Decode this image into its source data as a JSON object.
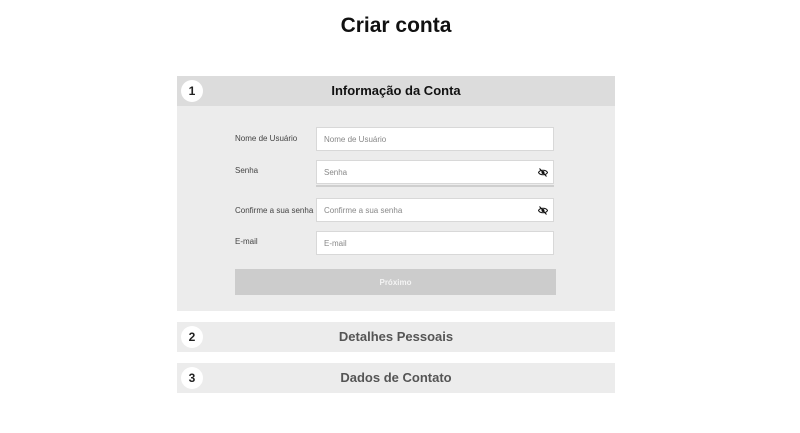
{
  "page": {
    "title": "Criar conta"
  },
  "steps": [
    {
      "number": "1",
      "title": "Informação da Conta"
    },
    {
      "number": "2",
      "title": "Detalhes Pessoais"
    },
    {
      "number": "3",
      "title": "Dados de Contato"
    }
  ],
  "form": {
    "username": {
      "label": "Nome de Usuário",
      "placeholder": "Nome de Usuário",
      "value": ""
    },
    "password": {
      "label": "Senha",
      "placeholder": "Senha",
      "value": ""
    },
    "confirm_password": {
      "label": "Confirme a sua senha",
      "placeholder": "Confirme a sua senha",
      "value": ""
    },
    "email": {
      "label": "E-mail",
      "placeholder": "E-mail",
      "value": ""
    },
    "next_label": "Próximo"
  },
  "icons": {
    "password_toggle": "eye-off-icon"
  },
  "colors": {
    "active_header": "#dcdcdc",
    "panel": "#ececec",
    "button_disabled": "#cccccc"
  }
}
